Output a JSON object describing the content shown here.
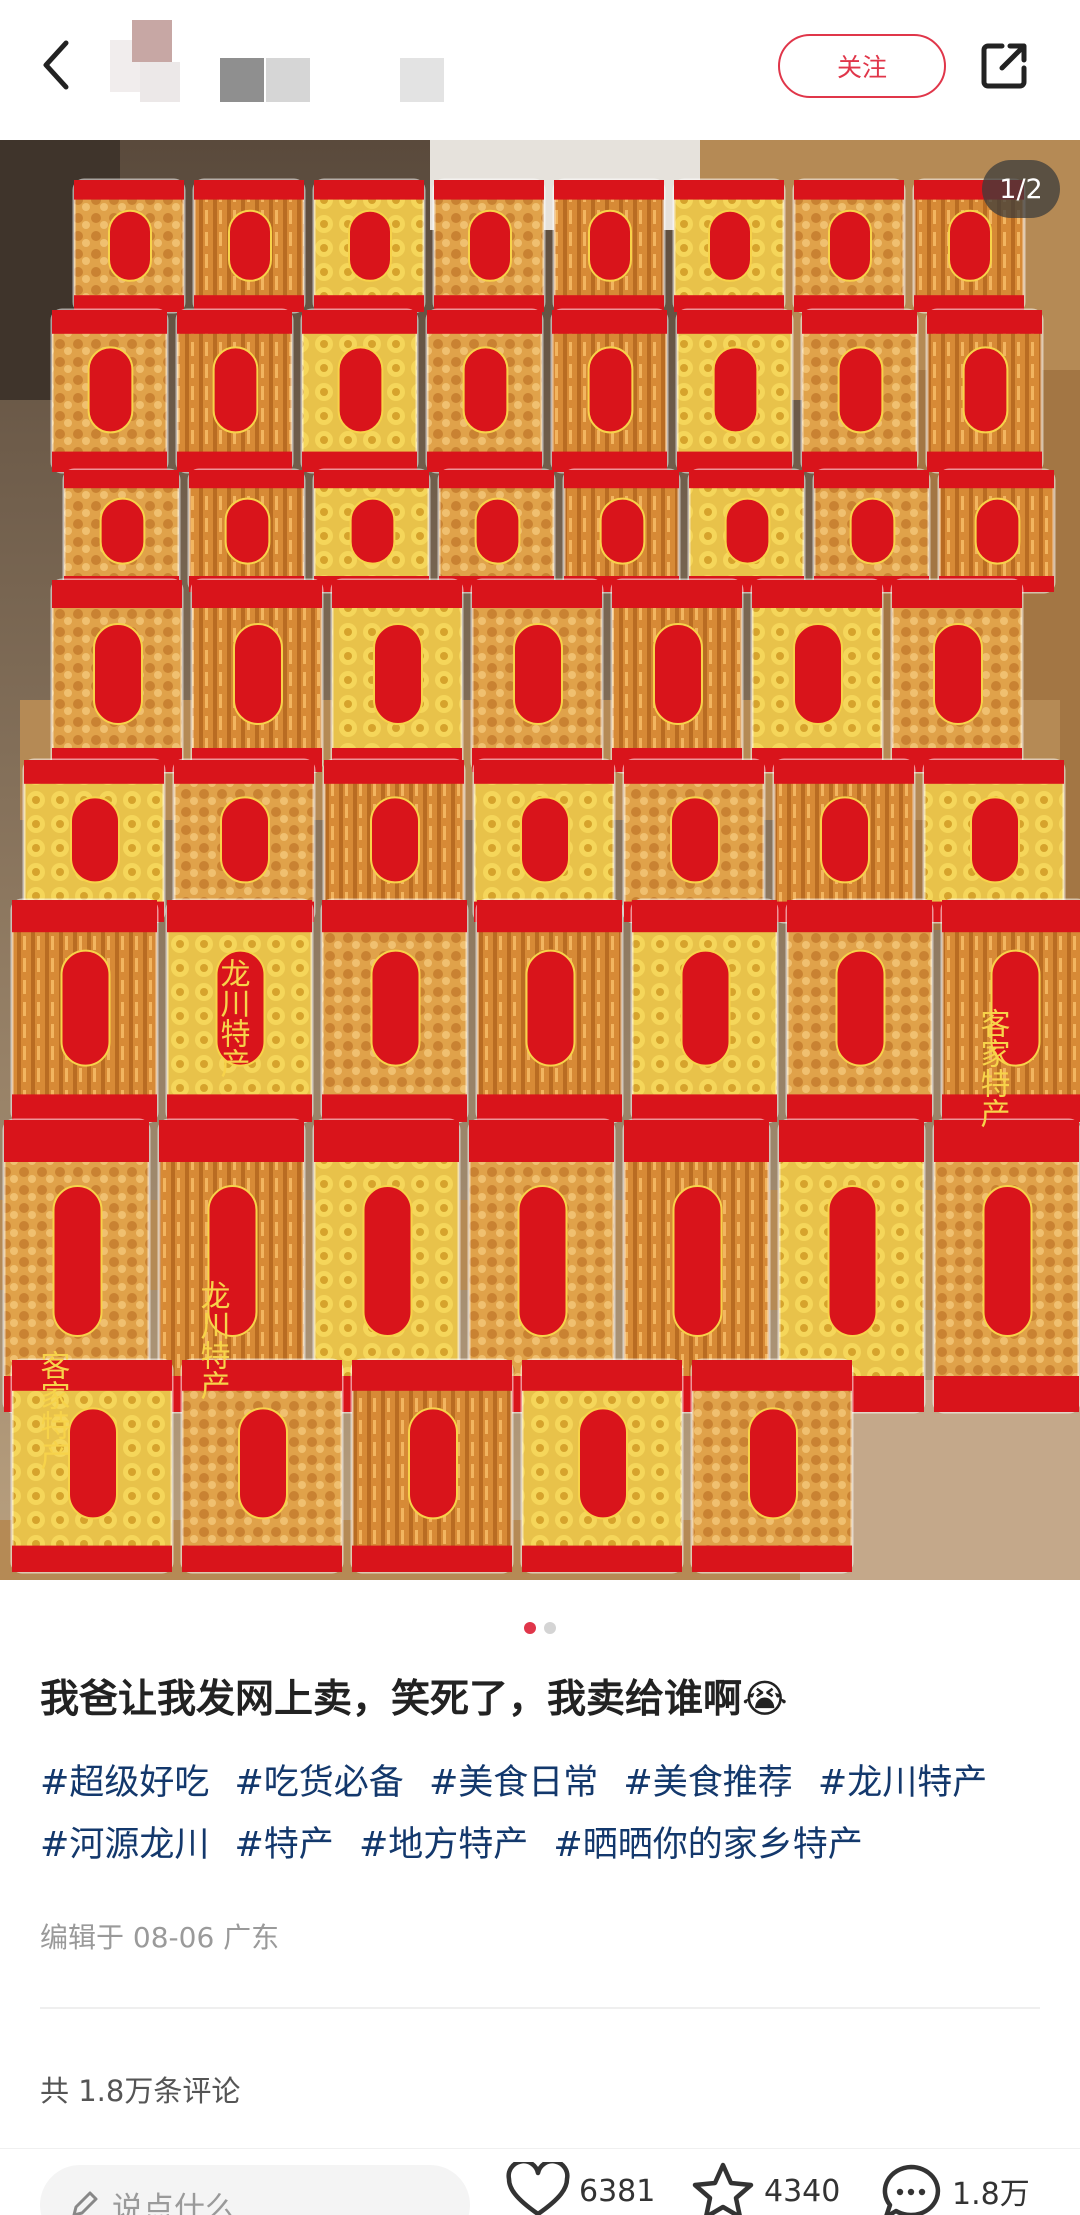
{
  "header": {
    "follow_label": "关注",
    "icons": {
      "back": "back-arrow-icon",
      "share": "share-icon"
    }
  },
  "gallery": {
    "page_indicator": "1/2",
    "current_page": 1,
    "total_pages": 2,
    "photo_labels": [
      "龙川特产",
      "客家特产",
      "龙川特产",
      "客家特产"
    ],
    "colors": {
      "bag_red": "#d9141b",
      "box": "#b58a55"
    }
  },
  "post": {
    "title": "我爸让我发网上卖，笑死了，我卖给谁啊😭",
    "tags": [
      "#超级好吃",
      "#吃货必备",
      "#美食日常",
      "#美食推荐",
      "#龙川特产",
      "#河源龙川",
      "#特产",
      "#地方特产",
      "#晒晒你的家乡特产"
    ],
    "meta": "编辑于 08-06 广东"
  },
  "comments": {
    "count_label": "共 1.8万条评论"
  },
  "bottom_bar": {
    "input_placeholder": "说点什么...",
    "likes": "6381",
    "collects": "4340",
    "comments": "1.8万"
  },
  "colors": {
    "accent": "#e0364a",
    "tag": "#13386c"
  }
}
